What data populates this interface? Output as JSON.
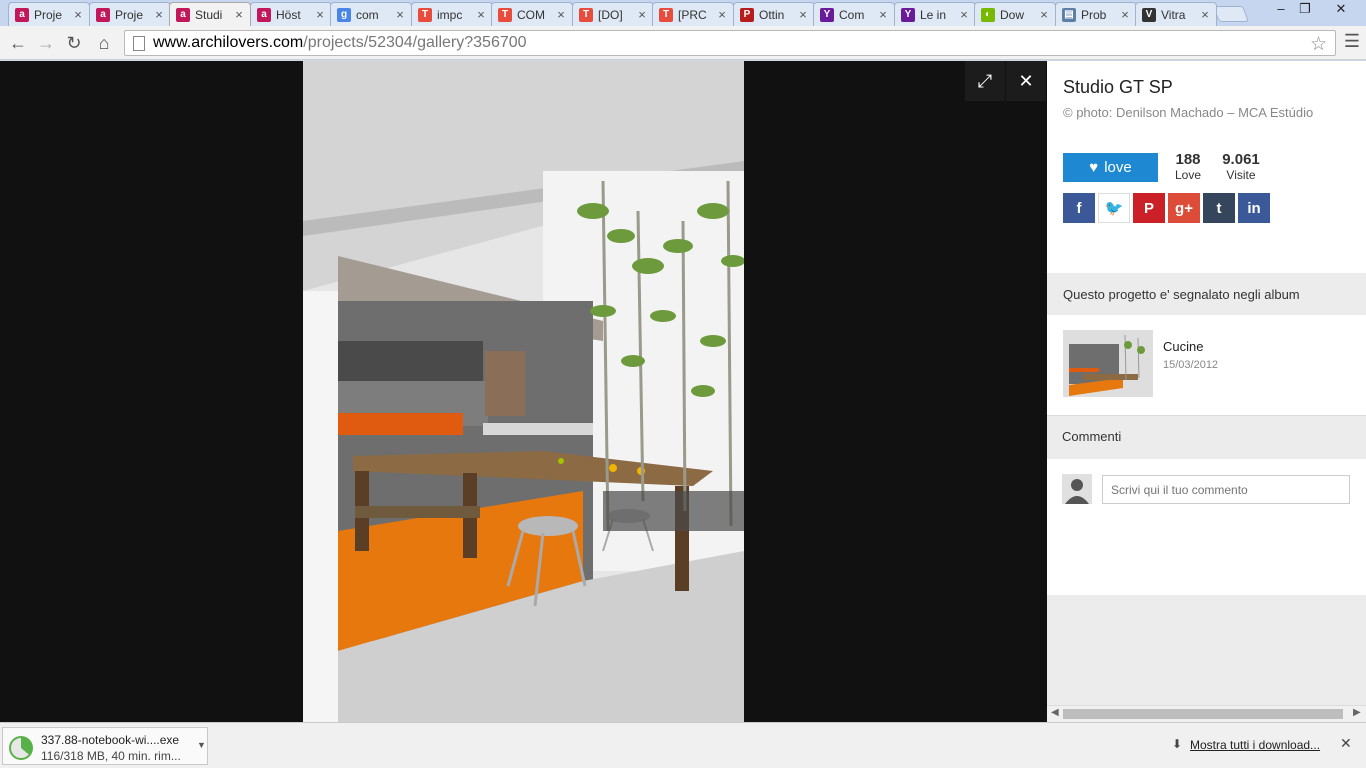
{
  "tabs": [
    {
      "title": "Proje",
      "icon": "archilovers-icon",
      "color": "#c2185b",
      "glyph": "a"
    },
    {
      "title": "Proje",
      "icon": "archilovers-icon",
      "color": "#c2185b",
      "glyph": "a"
    },
    {
      "title": "Studi",
      "icon": "archilovers-icon",
      "color": "#c2185b",
      "glyph": "a",
      "active": true
    },
    {
      "title": "Höst",
      "icon": "archilovers-icon",
      "color": "#c2185b",
      "glyph": "a"
    },
    {
      "title": "com",
      "icon": "google-icon",
      "color": "#4a86e8",
      "glyph": "g"
    },
    {
      "title": "impc",
      "icon": "t-icon",
      "color": "#e74c3c",
      "glyph": "T"
    },
    {
      "title": "COM",
      "icon": "t-icon",
      "color": "#e74c3c",
      "glyph": "T"
    },
    {
      "title": "[DO]",
      "icon": "t-icon",
      "color": "#e74c3c",
      "glyph": "T"
    },
    {
      "title": "[PRC",
      "icon": "t-icon",
      "color": "#e74c3c",
      "glyph": "T"
    },
    {
      "title": "Ottin",
      "icon": "pcw-icon",
      "color": "#b71c1c",
      "glyph": "P"
    },
    {
      "title": "Com",
      "icon": "yahoo-icon",
      "color": "#6a1b9a",
      "glyph": "Y"
    },
    {
      "title": "Le in",
      "icon": "yahoo-icon",
      "color": "#6a1b9a",
      "glyph": "Y"
    },
    {
      "title": "Dow",
      "icon": "nvidia-icon",
      "color": "#76b900",
      "glyph": "◐"
    },
    {
      "title": "Prob",
      "icon": "forum-icon",
      "color": "#5c7fa8",
      "glyph": "▤"
    },
    {
      "title": "Vitra",
      "icon": "vitra-icon",
      "color": "#333333",
      "glyph": "V"
    }
  ],
  "window": {
    "minimize": "–",
    "restore": "❐",
    "close": "✕"
  },
  "toolbar": {
    "url_host": "www.archilovers.com",
    "url_path": "/projects/52304/gallery?356700"
  },
  "project": {
    "title": "Studio GT SP",
    "credit": "© photo: Denilson Machado – MCA Estúdio",
    "love_label": "love",
    "love_count": "188",
    "love_caption": "Love",
    "visits_count": "9.061",
    "visits_caption": "Visite"
  },
  "social": [
    {
      "name": "facebook-icon",
      "glyph": "f",
      "color": "#3b5998",
      "fg": "#ffffff"
    },
    {
      "name": "twitter-icon",
      "glyph": "🐦",
      "color": "#ffffff",
      "fg": "#1da1f2"
    },
    {
      "name": "pinterest-icon",
      "glyph": "P",
      "color": "#cb2027",
      "fg": "#ffffff"
    },
    {
      "name": "google-plus-icon",
      "glyph": "g+",
      "color": "#dd4b39",
      "fg": "#ffffff"
    },
    {
      "name": "tumblr-icon",
      "glyph": "t",
      "color": "#35465c",
      "fg": "#ffffff"
    },
    {
      "name": "linkedin-icon",
      "glyph": "in",
      "color": "#3b5998",
      "fg": "#ffffff"
    }
  ],
  "albums": {
    "heading": "Questo progetto e' segnalato negli album",
    "items": [
      {
        "name": "Cucine",
        "date": "15/03/2012"
      }
    ]
  },
  "comments": {
    "heading": "Commenti",
    "placeholder": "Scrivi qui il tuo commento"
  },
  "download": {
    "filename": "337.88-notebook-wi....exe",
    "progress": "116/318 MB, 40 min. rim...",
    "progress_fraction": 0.36,
    "show_all": "Mostra tutti i download..."
  }
}
